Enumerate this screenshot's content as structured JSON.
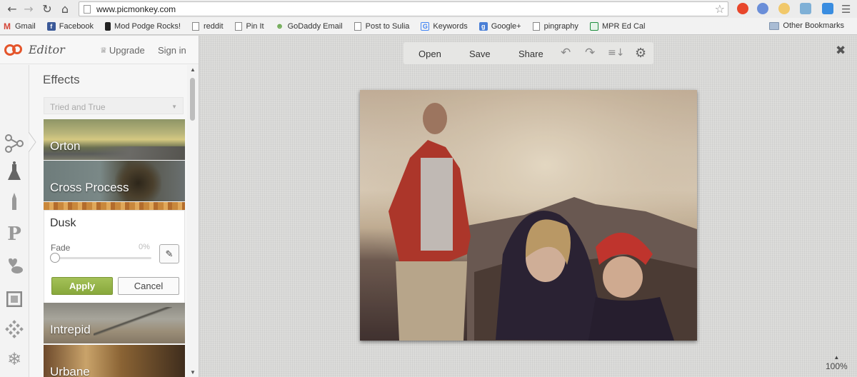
{
  "browser": {
    "url": "www.picmonkey.com",
    "bookmarks": [
      {
        "label": "Gmail",
        "icon": "gmail-icon",
        "color": "#d44638"
      },
      {
        "label": "Facebook",
        "icon": "facebook-icon",
        "color": "#3b5998"
      },
      {
        "label": "Mod Podge Rocks!",
        "icon": "modpodge-icon",
        "color": "#222222"
      },
      {
        "label": "reddit",
        "icon": "page-icon",
        "color": ""
      },
      {
        "label": "Pin It",
        "icon": "page-icon",
        "color": ""
      },
      {
        "label": "GoDaddy Email",
        "icon": "godaddy-icon",
        "color": "#6aa84f"
      },
      {
        "label": "Post to Sulia",
        "icon": "page-icon",
        "color": ""
      },
      {
        "label": "Keywords",
        "icon": "google-icon",
        "color": "#4285f4"
      },
      {
        "label": "Google+",
        "icon": "googleplus-icon",
        "color": "#4a7fd6"
      },
      {
        "label": "pingraphy",
        "icon": "page-icon",
        "color": ""
      },
      {
        "label": "MPR Ed Cal",
        "icon": "sheets-icon",
        "color": "#1e8e3e"
      }
    ],
    "other_bookmarks": "Other Bookmarks"
  },
  "app": {
    "logo_text": "Editor",
    "upgrade": "Upgrade",
    "sign_in": "Sign in",
    "accent": "#e4552b"
  },
  "tools": [
    "basic-edits-icon",
    "effects-icon",
    "touch-up-icon",
    "overlays-icon",
    "textures-icon",
    "frames-icon",
    "themes-icon",
    "seasonal-icon"
  ],
  "effects": {
    "title": "Effects",
    "category": "Tried and True",
    "items": [
      "Orton",
      "Cross Process",
      "Intrepid",
      "Urbane"
    ],
    "active": {
      "name": "Dusk",
      "fade_label": "Fade",
      "fade_value": "0%",
      "apply": "Apply",
      "cancel": "Cancel"
    }
  },
  "menu": {
    "open": "Open",
    "save": "Save",
    "share": "Share"
  },
  "zoom": "100%"
}
